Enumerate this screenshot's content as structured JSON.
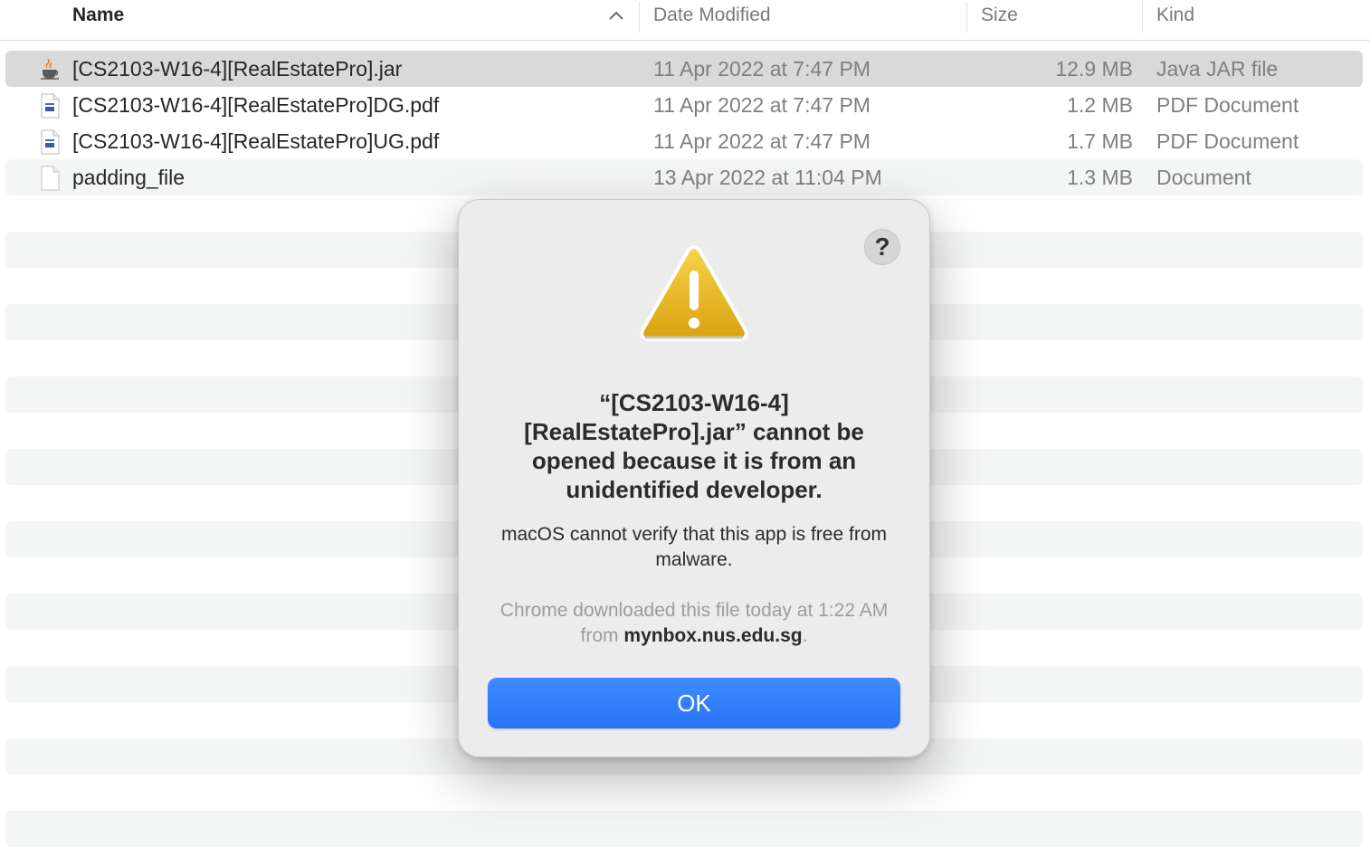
{
  "columns": {
    "name": "Name",
    "date_modified": "Date Modified",
    "size": "Size",
    "kind": "Kind"
  },
  "sort_icon": "chevron-up-icon",
  "files": [
    {
      "name": "[CS2103-W16-4][RealEstatePro].jar",
      "date": "11 Apr 2022 at 7:47 PM",
      "size": "12.9 MB",
      "kind": "Java JAR file",
      "icon": "java-jar-icon",
      "selected": true
    },
    {
      "name": "[CS2103-W16-4][RealEstatePro]DG.pdf",
      "date": "11 Apr 2022 at 7:47 PM",
      "size": "1.2 MB",
      "kind": "PDF Document",
      "icon": "pdf-file-icon"
    },
    {
      "name": "[CS2103-W16-4][RealEstatePro]UG.pdf",
      "date": "11 Apr 2022 at 7:47 PM",
      "size": "1.7 MB",
      "kind": "PDF Document",
      "icon": "pdf-file-icon"
    },
    {
      "name": "padding_file",
      "date": "13 Apr 2022 at 11:04 PM",
      "size": "1.3 MB",
      "kind": "Document",
      "icon": "generic-file-icon"
    }
  ],
  "dialog": {
    "help_label": "?",
    "icon": "warning-icon",
    "title": "“[CS2103-W16-4] [RealEstatePro].jar” cannot be opened because it is from an unidentified developer.",
    "message": "macOS cannot verify that this app is free from malware.",
    "info_prefix": "Chrome downloaded this file today at 1:22 AM from ",
    "info_domain": "mynbox.nus.edu.sg",
    "info_suffix": ".",
    "ok_label": "OK"
  },
  "colors": {
    "accent": "#2a74f5",
    "warning": "#e7b21a"
  }
}
